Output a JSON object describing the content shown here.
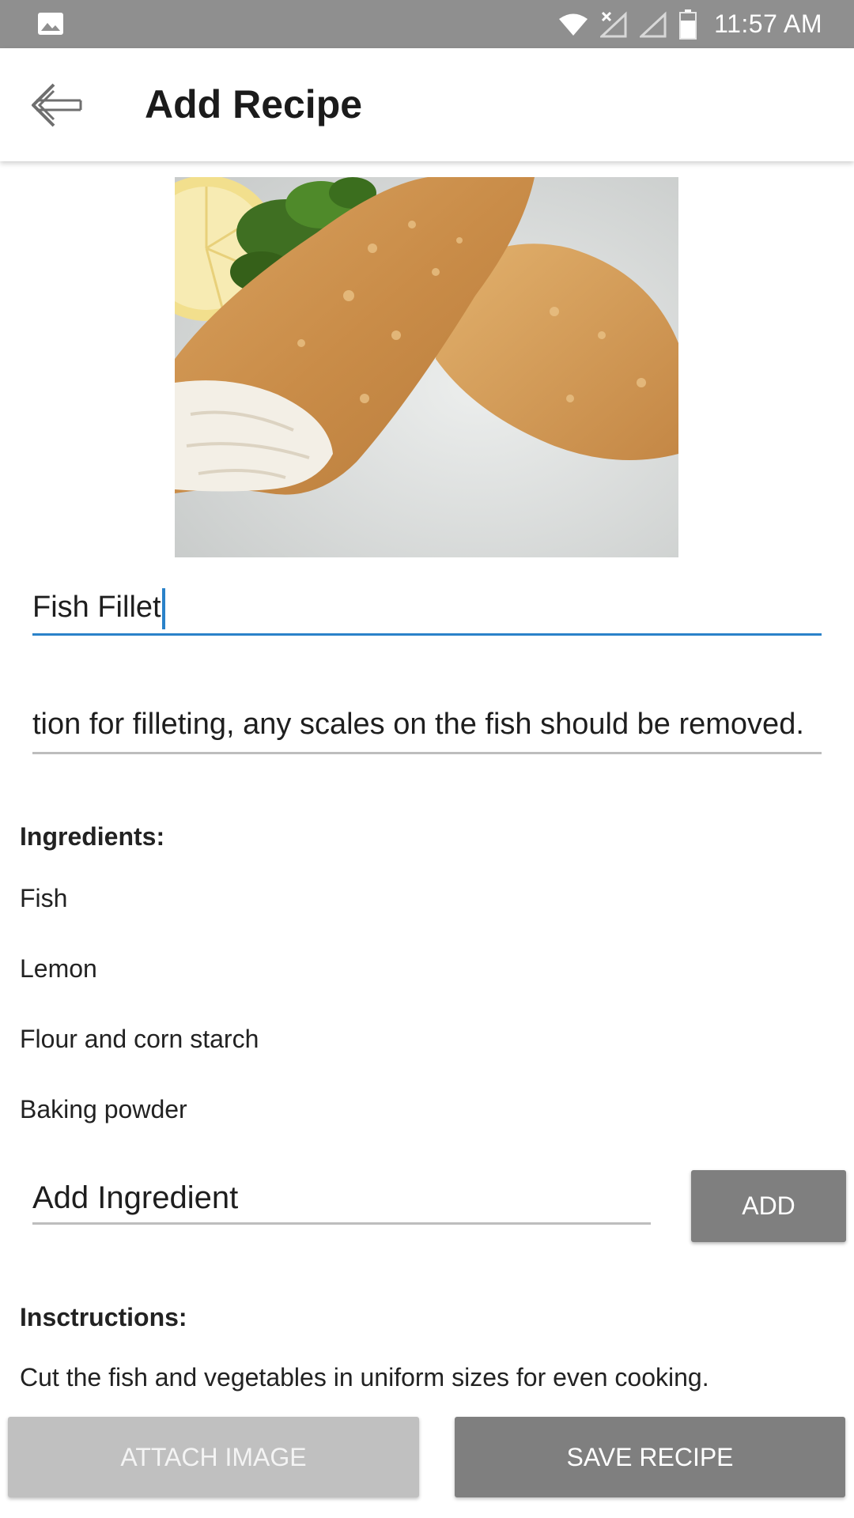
{
  "status_bar": {
    "time": "11:57 AM",
    "icons": [
      "gallery-notification-icon",
      "wifi-icon",
      "no-sim-signal-icon",
      "signal-icon",
      "battery-icon"
    ]
  },
  "app_bar": {
    "title": "Add Recipe",
    "back_icon": "back-arrow-icon"
  },
  "recipe": {
    "image_alt": "breaded-fish-fillet-photo",
    "name_value": "Fish Fillet",
    "description_value": "tion for filleting, any scales on the fish should be removed."
  },
  "ingredients": {
    "label": "Ingredients:",
    "items": [
      "Fish",
      "Lemon",
      "Flour and corn starch",
      "Baking powder"
    ],
    "add_placeholder": "Add Ingredient",
    "add_button": "ADD"
  },
  "instructions": {
    "label": "Insctructions:",
    "items": [
      "Cut the fish and vegetables in uniform sizes for even cooking."
    ]
  },
  "actions": {
    "attach_image": "ATTACH IMAGE",
    "save_recipe": "SAVE RECIPE"
  },
  "colors": {
    "status_bar": "#8f8f8f",
    "focus_underline": "#2a82c9",
    "button_gray": "#7f7f7f",
    "button_disabled": "#c0c0c0"
  }
}
